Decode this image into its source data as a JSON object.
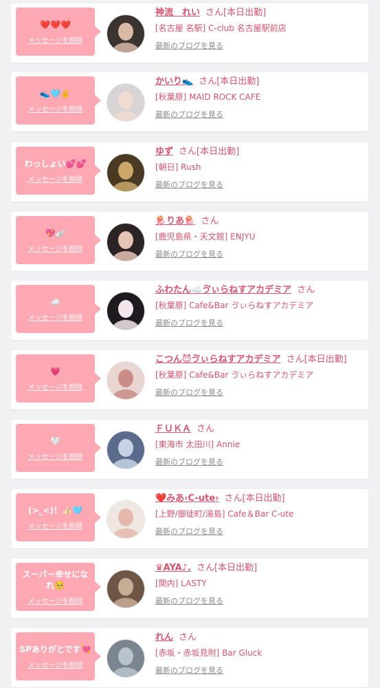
{
  "delete_label": "メッセージを削除",
  "blog_label": "最新のブログを見る",
  "san_label": "さん",
  "colors": {
    "accent": "#d9526e",
    "bubble": "#fda8b3",
    "background": "#f1f1f3"
  },
  "cards": [
    {
      "message": "❤️❤️❤️",
      "name": "神流　れい",
      "status": "[本日出勤]",
      "shop": "[名古屋 名駅] C-club 名古屋駅前店"
    },
    {
      "message": "👟🩵✌️",
      "name": "かいり👟",
      "status": "[本日出勤]",
      "shop": "[秋葉原] MAID ROCK CAFE"
    },
    {
      "message": "わっしょい💕💕",
      "name": "ゆず",
      "status": "[本日出勤]",
      "shop": "[朝日] Rush"
    },
    {
      "message": "💖🪽",
      "name": "🪼りあ🪼",
      "status": "",
      "shop": "[鹿児島県・天文館] ENJYU"
    },
    {
      "message": "☁️",
      "name": "ふわたん☁️ゔぃらねすアカデミア",
      "status": "",
      "shop": "[秋葉原] Cafe&Bar ゔぃらねすアカデミア"
    },
    {
      "message": "💗",
      "name": "こつん😈ゔぃらねすアカデミア",
      "status": "[本日出勤]",
      "shop": "[秋葉原] Cafe&Bar ゔぃらねすアカデミア"
    },
    {
      "message": "🤍",
      "name": "ＦＵＫＡ",
      "status": "",
      "shop": "[東海市 太田川] Annie"
    },
    {
      "message": "(>_<)！👍🏻🩵",
      "name": "❤️みあ‹C-ute›",
      "status": "[本日出勤]",
      "shop": "[上野/御徒町/湯島] Cafe＆Bar C-ute"
    },
    {
      "message": "スーパー幸せになれ🥺",
      "name": "♛AYA♪.",
      "status": "[本日出勤]",
      "shop": "[関内] LASTY"
    },
    {
      "message": "SPありがとです💘",
      "name": "れん",
      "status": "",
      "shop": "[赤坂・赤坂見附] Bar Gluck"
    }
  ]
}
